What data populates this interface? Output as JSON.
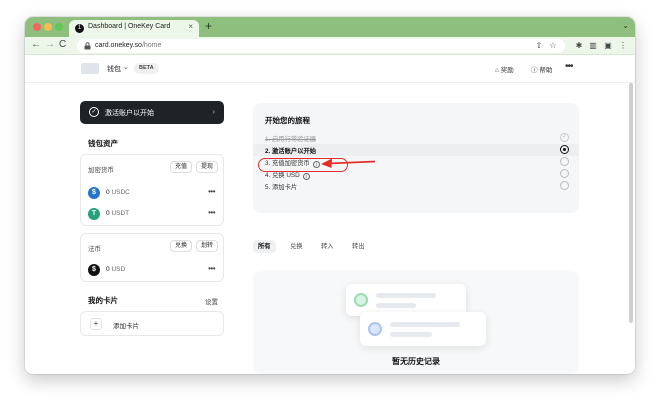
{
  "browser": {
    "tab_title": "Dashboard | OneKey Card",
    "tab_favicon": "onekey-logo",
    "url_host": "card.onekey.so",
    "url_path": "/home"
  },
  "app": {
    "wallet_name": "钱包",
    "beta_badge": "BETA",
    "rewards_label": "奖励",
    "help_label": "帮助",
    "more_label": "•••"
  },
  "activate": {
    "label": "激活账户以开始"
  },
  "wallet_assets": {
    "title": "钱包资产",
    "crypto": {
      "label": "加密货币",
      "deposit_label": "充值",
      "withdraw_label": "提现",
      "items": [
        {
          "amount": "0",
          "unit": "USDC",
          "icon": "usdc-coin-icon",
          "color": "#2775ca"
        },
        {
          "amount": "0",
          "unit": "USDT",
          "icon": "usdt-coin-icon",
          "color": "#26a17b"
        }
      ]
    },
    "fiat": {
      "label": "法币",
      "exchange_label": "兑换",
      "transfer_label": "划转",
      "items": [
        {
          "amount": "0",
          "unit": "USD",
          "icon": "usd-coin-icon",
          "color": "#111111"
        }
      ]
    }
  },
  "my_cards": {
    "title": "我的卡片",
    "settings_label": "设置",
    "add_label": "添加卡片"
  },
  "journey": {
    "title": "开始您的旅程",
    "steps": [
      {
        "label": "1. 启用行常验证器",
        "state": "done"
      },
      {
        "label": "2. 激活账户以开始",
        "state": "current"
      },
      {
        "label": "3. 充值加密货币",
        "state": "todo"
      },
      {
        "label": "4. 兑换 USD",
        "state": "todo"
      },
      {
        "label": "5. 添加卡片",
        "state": "todo"
      }
    ]
  },
  "filters": [
    "所有",
    "兑换",
    "转入",
    "转出"
  ],
  "empty_state": {
    "text": "暂无历史记录"
  },
  "colors": {
    "annotation_red": "#e32d2d",
    "tab_strip": "#8fbf7f",
    "accent_dark": "#1f2328"
  }
}
